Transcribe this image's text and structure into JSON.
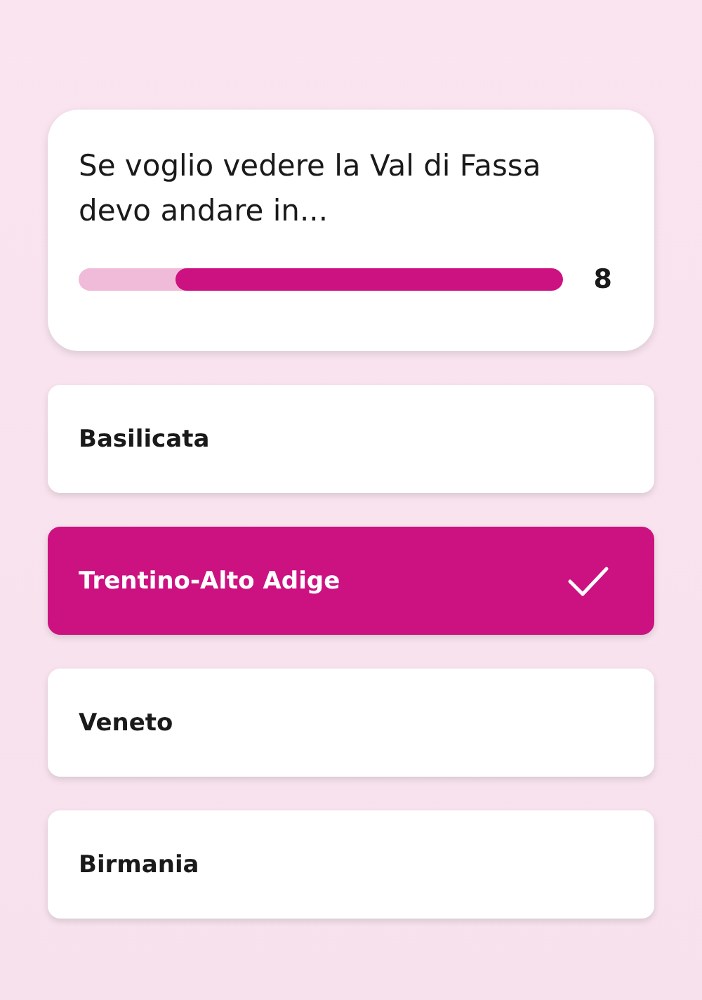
{
  "question": {
    "text": "Se voglio vedere la Val di Fassa devo andare in...",
    "timer": {
      "level": 0.8,
      "reading": "8"
    }
  },
  "answers": [
    {
      "label": "Basilicata",
      "selected": false
    },
    {
      "label": "Trentino-Alto Adige",
      "selected": true
    },
    {
      "label": "Veneto",
      "selected": false
    },
    {
      "label": "Birmania",
      "selected": false
    }
  ]
}
